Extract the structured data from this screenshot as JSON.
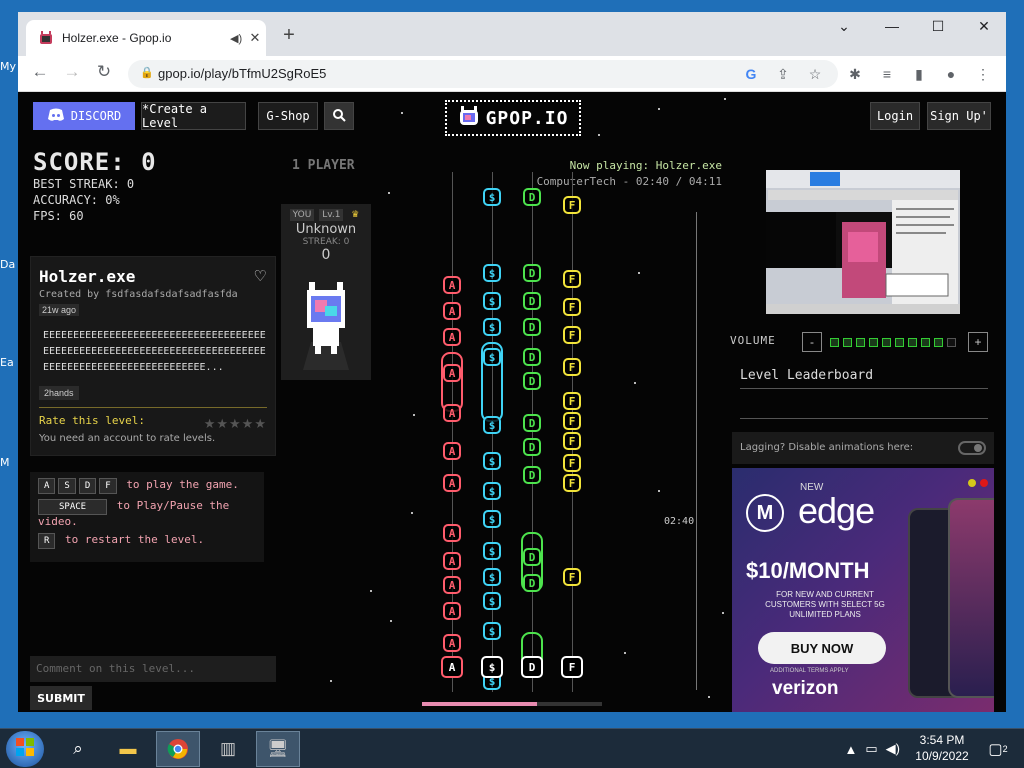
{
  "desktop": {
    "icon_labels": [
      "My",
      "Da",
      "Ea",
      "M"
    ]
  },
  "browser": {
    "tab_title": "Holzer.exe - Gpop.io",
    "url": "gpop.io/play/bTfmU2SgRoE5"
  },
  "site": {
    "logo": "GPOP.IO",
    "nav": {
      "discord": "DISCORD",
      "create": "*Create a Level",
      "gshop": "G-Shop",
      "login": "Login",
      "signup": "Sign Up'"
    }
  },
  "game": {
    "score": "SCORE: 0",
    "best_streak": "BEST STREAK: 0",
    "accuracy": "ACCURACY: 0%",
    "fps": "FPS: 60",
    "player_count": "1 PLAYER",
    "player": {
      "you": "YOU",
      "level": "Lv.1",
      "name": "Unknown",
      "streak": "STREAK: 0",
      "value": "0"
    },
    "now_playing": "Now playing: Holzer.exe",
    "track_info": "ComputerTech - 02:40 / 04:11",
    "timeline_label": "02:40",
    "progress_fraction": 0.64
  },
  "level": {
    "title": "Holzer.exe",
    "creator": "Created by fsdfasdafsdafsadfasfda",
    "age": "21w ago",
    "description": "EEEEEEEEEEEEEEEEEEEEEEEEEEEEEEEEEEEEEEEEEEEEEEEEEEEEEEEEEEEEEEEEEEEEEEEEEEEEEEEEEEEEEEEEEEEEEEEEEEEEE...",
    "tag": "2hands",
    "rate_label": "Rate this level:",
    "account_note": "You need an account to rate levels."
  },
  "controls": {
    "keys": [
      "A",
      "S",
      "D",
      "F"
    ],
    "play_text": "to play the game.",
    "space_key": "SPACE",
    "pause_text": "to Play/Pause the video.",
    "restart_key": "R",
    "restart_text": "to restart the level."
  },
  "comment": {
    "placeholder": "Comment on this level...",
    "submit": "SUBMIT"
  },
  "right_panel": {
    "volume_label": "VOLUME",
    "volume_level": 9,
    "volume_max": 10,
    "leaderboard_title": "Level Leaderboard",
    "lag_text": "Lagging? Disable animations here:"
  },
  "ad": {
    "new": "NEW",
    "product": "edge",
    "price": "$10/MONTH",
    "subtext": "FOR NEW AND CURRENT CUSTOMERS WITH SELECT 5G UNLIMITED PLANS",
    "cta": "BUY NOW",
    "fine_print": "ADDITIONAL TERMS APPLY",
    "brand": "verizon"
  },
  "taskbar": {
    "time": "3:54 PM",
    "date": "10/9/2022",
    "notification_count": "2"
  },
  "colors": {
    "lane_a": "#ff5c6c",
    "lane_s": "#3fd3f5",
    "lane_d": "#4de34d",
    "lane_f": "#f2e43a"
  }
}
